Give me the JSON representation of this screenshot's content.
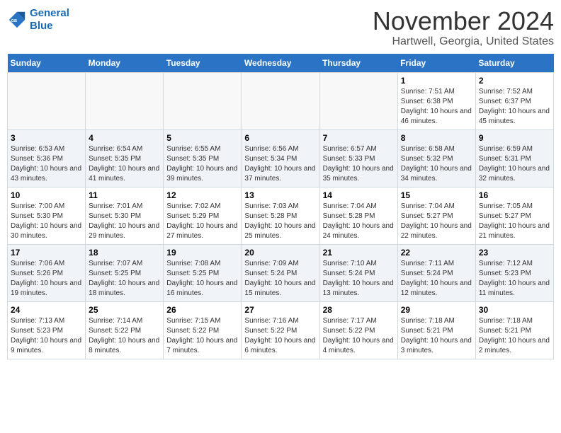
{
  "logo": {
    "line1": "General",
    "line2": "Blue"
  },
  "title": "November 2024",
  "subtitle": "Hartwell, Georgia, United States",
  "days_of_week": [
    "Sunday",
    "Monday",
    "Tuesday",
    "Wednesday",
    "Thursday",
    "Friday",
    "Saturday"
  ],
  "weeks": [
    [
      {
        "day": "",
        "info": ""
      },
      {
        "day": "",
        "info": ""
      },
      {
        "day": "",
        "info": ""
      },
      {
        "day": "",
        "info": ""
      },
      {
        "day": "",
        "info": ""
      },
      {
        "day": "1",
        "info": "Sunrise: 7:51 AM\nSunset: 6:38 PM\nDaylight: 10 hours and 46 minutes."
      },
      {
        "day": "2",
        "info": "Sunrise: 7:52 AM\nSunset: 6:37 PM\nDaylight: 10 hours and 45 minutes."
      }
    ],
    [
      {
        "day": "3",
        "info": "Sunrise: 6:53 AM\nSunset: 5:36 PM\nDaylight: 10 hours and 43 minutes."
      },
      {
        "day": "4",
        "info": "Sunrise: 6:54 AM\nSunset: 5:35 PM\nDaylight: 10 hours and 41 minutes."
      },
      {
        "day": "5",
        "info": "Sunrise: 6:55 AM\nSunset: 5:35 PM\nDaylight: 10 hours and 39 minutes."
      },
      {
        "day": "6",
        "info": "Sunrise: 6:56 AM\nSunset: 5:34 PM\nDaylight: 10 hours and 37 minutes."
      },
      {
        "day": "7",
        "info": "Sunrise: 6:57 AM\nSunset: 5:33 PM\nDaylight: 10 hours and 35 minutes."
      },
      {
        "day": "8",
        "info": "Sunrise: 6:58 AM\nSunset: 5:32 PM\nDaylight: 10 hours and 34 minutes."
      },
      {
        "day": "9",
        "info": "Sunrise: 6:59 AM\nSunset: 5:31 PM\nDaylight: 10 hours and 32 minutes."
      }
    ],
    [
      {
        "day": "10",
        "info": "Sunrise: 7:00 AM\nSunset: 5:30 PM\nDaylight: 10 hours and 30 minutes."
      },
      {
        "day": "11",
        "info": "Sunrise: 7:01 AM\nSunset: 5:30 PM\nDaylight: 10 hours and 29 minutes."
      },
      {
        "day": "12",
        "info": "Sunrise: 7:02 AM\nSunset: 5:29 PM\nDaylight: 10 hours and 27 minutes."
      },
      {
        "day": "13",
        "info": "Sunrise: 7:03 AM\nSunset: 5:28 PM\nDaylight: 10 hours and 25 minutes."
      },
      {
        "day": "14",
        "info": "Sunrise: 7:04 AM\nSunset: 5:28 PM\nDaylight: 10 hours and 24 minutes."
      },
      {
        "day": "15",
        "info": "Sunrise: 7:04 AM\nSunset: 5:27 PM\nDaylight: 10 hours and 22 minutes."
      },
      {
        "day": "16",
        "info": "Sunrise: 7:05 AM\nSunset: 5:27 PM\nDaylight: 10 hours and 21 minutes."
      }
    ],
    [
      {
        "day": "17",
        "info": "Sunrise: 7:06 AM\nSunset: 5:26 PM\nDaylight: 10 hours and 19 minutes."
      },
      {
        "day": "18",
        "info": "Sunrise: 7:07 AM\nSunset: 5:25 PM\nDaylight: 10 hours and 18 minutes."
      },
      {
        "day": "19",
        "info": "Sunrise: 7:08 AM\nSunset: 5:25 PM\nDaylight: 10 hours and 16 minutes."
      },
      {
        "day": "20",
        "info": "Sunrise: 7:09 AM\nSunset: 5:24 PM\nDaylight: 10 hours and 15 minutes."
      },
      {
        "day": "21",
        "info": "Sunrise: 7:10 AM\nSunset: 5:24 PM\nDaylight: 10 hours and 13 minutes."
      },
      {
        "day": "22",
        "info": "Sunrise: 7:11 AM\nSunset: 5:24 PM\nDaylight: 10 hours and 12 minutes."
      },
      {
        "day": "23",
        "info": "Sunrise: 7:12 AM\nSunset: 5:23 PM\nDaylight: 10 hours and 11 minutes."
      }
    ],
    [
      {
        "day": "24",
        "info": "Sunrise: 7:13 AM\nSunset: 5:23 PM\nDaylight: 10 hours and 9 minutes."
      },
      {
        "day": "25",
        "info": "Sunrise: 7:14 AM\nSunset: 5:22 PM\nDaylight: 10 hours and 8 minutes."
      },
      {
        "day": "26",
        "info": "Sunrise: 7:15 AM\nSunset: 5:22 PM\nDaylight: 10 hours and 7 minutes."
      },
      {
        "day": "27",
        "info": "Sunrise: 7:16 AM\nSunset: 5:22 PM\nDaylight: 10 hours and 6 minutes."
      },
      {
        "day": "28",
        "info": "Sunrise: 7:17 AM\nSunset: 5:22 PM\nDaylight: 10 hours and 4 minutes."
      },
      {
        "day": "29",
        "info": "Sunrise: 7:18 AM\nSunset: 5:21 PM\nDaylight: 10 hours and 3 minutes."
      },
      {
        "day": "30",
        "info": "Sunrise: 7:18 AM\nSunset: 5:21 PM\nDaylight: 10 hours and 2 minutes."
      }
    ]
  ]
}
